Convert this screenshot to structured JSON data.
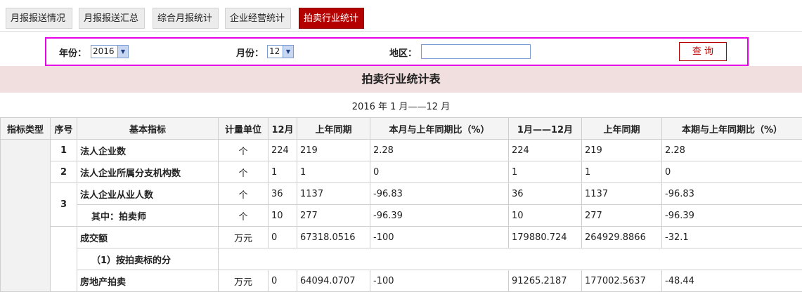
{
  "tabs": [
    "月报报送情况",
    "月报报送汇总",
    "综合月报统计",
    "企业经营统计",
    "拍卖行业统计"
  ],
  "filter": {
    "year_label": "年份：",
    "year_value": "2016",
    "month_label": "月份：",
    "month_value": "12",
    "region_label": "地区：",
    "region_value": "",
    "query_button": "查 询"
  },
  "report": {
    "title": "拍卖行业统计表",
    "period": "2016 年 1 月——12 月"
  },
  "table": {
    "headers": [
      "指标类型",
      "序号",
      "基本指标",
      "计量单位",
      "12月",
      "上年同期",
      "本月与上年同期比（%）",
      "1月——12月",
      "上年同期",
      "本期与上年同期比（%）"
    ],
    "rows": [
      {
        "seq": "1",
        "name": "法人企业数",
        "unit": "个",
        "m": "224",
        "m_prev": "219",
        "m_ratio": "2.28",
        "ytd": "224",
        "ytd_prev": "219",
        "ytd_ratio": "2.28"
      },
      {
        "seq": "2",
        "name": "法人企业所属分支机构数",
        "unit": "个",
        "m": "1",
        "m_prev": "1",
        "m_ratio": "0",
        "ytd": "1",
        "ytd_prev": "1",
        "ytd_ratio": "0"
      },
      {
        "seq": "3",
        "name": "法人企业从业人数",
        "unit": "个",
        "m": "36",
        "m_prev": "1137",
        "m_ratio": "-96.83",
        "ytd": "36",
        "ytd_prev": "1137",
        "ytd_ratio": "-96.83"
      },
      {
        "seq": "",
        "name": "其中：拍卖师",
        "unit": "个",
        "m": "10",
        "m_prev": "277",
        "m_ratio": "-96.39",
        "ytd": "10",
        "ytd_prev": "277",
        "ytd_ratio": "-96.39"
      },
      {
        "seq": "",
        "name": "成交额",
        "unit": "万元",
        "m": "0",
        "m_prev": "67318.0516",
        "m_ratio": "-100",
        "ytd": "179880.724",
        "ytd_prev": "264929.8866",
        "ytd_ratio": "-32.1"
      },
      {
        "seq": "",
        "name": "（1）按拍卖标的分",
        "unit": "",
        "m": "",
        "m_prev": "",
        "m_ratio": "",
        "ytd": "",
        "ytd_prev": "",
        "ytd_ratio": ""
      },
      {
        "seq": "",
        "name": "房地产拍卖",
        "unit": "万元",
        "m": "0",
        "m_prev": "64094.0707",
        "m_ratio": "-100",
        "ytd": "91265.2187",
        "ytd_prev": "177002.5637",
        "ytd_ratio": "-48.44"
      }
    ]
  }
}
